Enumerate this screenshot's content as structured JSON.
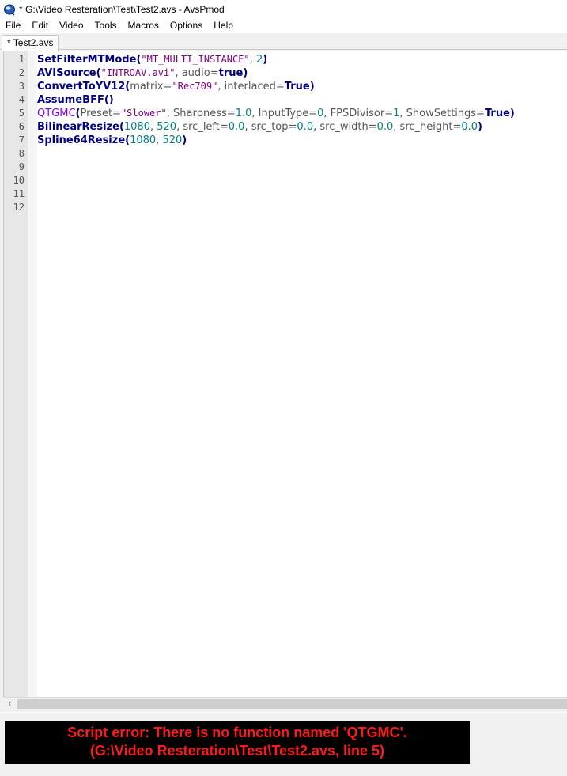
{
  "window": {
    "title": "* G:\\Video Resteration\\Test\\Test2.avs - AvsPmod",
    "icon": "avspmod-app-icon"
  },
  "menu": [
    "File",
    "Edit",
    "Video",
    "Tools",
    "Macros",
    "Options",
    "Help"
  ],
  "tabs": [
    {
      "label": "* Test2.avs",
      "active": true
    }
  ],
  "editor": {
    "line_numbers": [
      "1",
      "2",
      "3",
      "4",
      "5",
      "6",
      "7",
      "8",
      "9",
      "10",
      "11",
      "12"
    ],
    "lines": [
      [
        {
          "t": "SetFilterMTMode",
          "c": "fn"
        },
        {
          "t": "(",
          "c": "par"
        },
        {
          "t": "\"MT_MULTI_INSTANCE\"",
          "c": "str"
        },
        {
          "t": ", ",
          "c": "arg"
        },
        {
          "t": "2",
          "c": "num"
        },
        {
          "t": ")",
          "c": "par"
        }
      ],
      [
        {
          "t": "AVISource",
          "c": "fn"
        },
        {
          "t": "(",
          "c": "par"
        },
        {
          "t": "\"INTROAV.avi\"",
          "c": "str"
        },
        {
          "t": ", audio=",
          "c": "arg"
        },
        {
          "t": "true",
          "c": "kw"
        },
        {
          "t": ")",
          "c": "par"
        }
      ],
      [
        {
          "t": "ConvertToYV12",
          "c": "fn"
        },
        {
          "t": "(",
          "c": "par"
        },
        {
          "t": "matrix=",
          "c": "arg"
        },
        {
          "t": "\"Rec709\"",
          "c": "str"
        },
        {
          "t": ", interlaced=",
          "c": "arg"
        },
        {
          "t": "True",
          "c": "kw"
        },
        {
          "t": ")",
          "c": "par"
        }
      ],
      [
        {
          "t": "AssumeBFF",
          "c": "fn"
        },
        {
          "t": "()",
          "c": "par"
        }
      ],
      [
        {
          "t": "QTGMC",
          "c": "fn-err"
        },
        {
          "t": "(",
          "c": "par"
        },
        {
          "t": "Preset=",
          "c": "arg"
        },
        {
          "t": "\"Slower\"",
          "c": "str"
        },
        {
          "t": ", Sharpness=",
          "c": "arg"
        },
        {
          "t": "1.0",
          "c": "num"
        },
        {
          "t": ", InputType=",
          "c": "arg"
        },
        {
          "t": "0",
          "c": "num"
        },
        {
          "t": ", FPSDivisor=",
          "c": "arg"
        },
        {
          "t": "1",
          "c": "num"
        },
        {
          "t": ", ShowSettings=",
          "c": "arg"
        },
        {
          "t": "True",
          "c": "kw"
        },
        {
          "t": ")",
          "c": "par"
        }
      ],
      [
        {
          "t": "BilinearResize",
          "c": "fn"
        },
        {
          "t": "(",
          "c": "par"
        },
        {
          "t": "1080",
          "c": "num"
        },
        {
          "t": ", ",
          "c": "arg"
        },
        {
          "t": "520",
          "c": "num"
        },
        {
          "t": ", src_left=",
          "c": "arg"
        },
        {
          "t": "0.0",
          "c": "num"
        },
        {
          "t": ", src_top=",
          "c": "arg"
        },
        {
          "t": "0.0",
          "c": "num"
        },
        {
          "t": ", src_width=",
          "c": "arg"
        },
        {
          "t": "0.0",
          "c": "num"
        },
        {
          "t": ", src_height=",
          "c": "arg"
        },
        {
          "t": "0.0",
          "c": "num"
        },
        {
          "t": ")",
          "c": "par"
        }
      ],
      [
        {
          "t": "Spline64Resize",
          "c": "fn"
        },
        {
          "t": "(",
          "c": "par"
        },
        {
          "t": "1080",
          "c": "num"
        },
        {
          "t": ", ",
          "c": "arg"
        },
        {
          "t": "520",
          "c": "num"
        },
        {
          "t": ")",
          "c": "par"
        }
      ],
      [],
      [],
      [],
      [],
      []
    ]
  },
  "scrollbar": {
    "left_arrow": "‹"
  },
  "error": {
    "line1": "Script error: There is no function named 'QTGMC'.",
    "line2": "(G:\\Video Resteration\\Test\\Test2.avs, line 5)"
  }
}
